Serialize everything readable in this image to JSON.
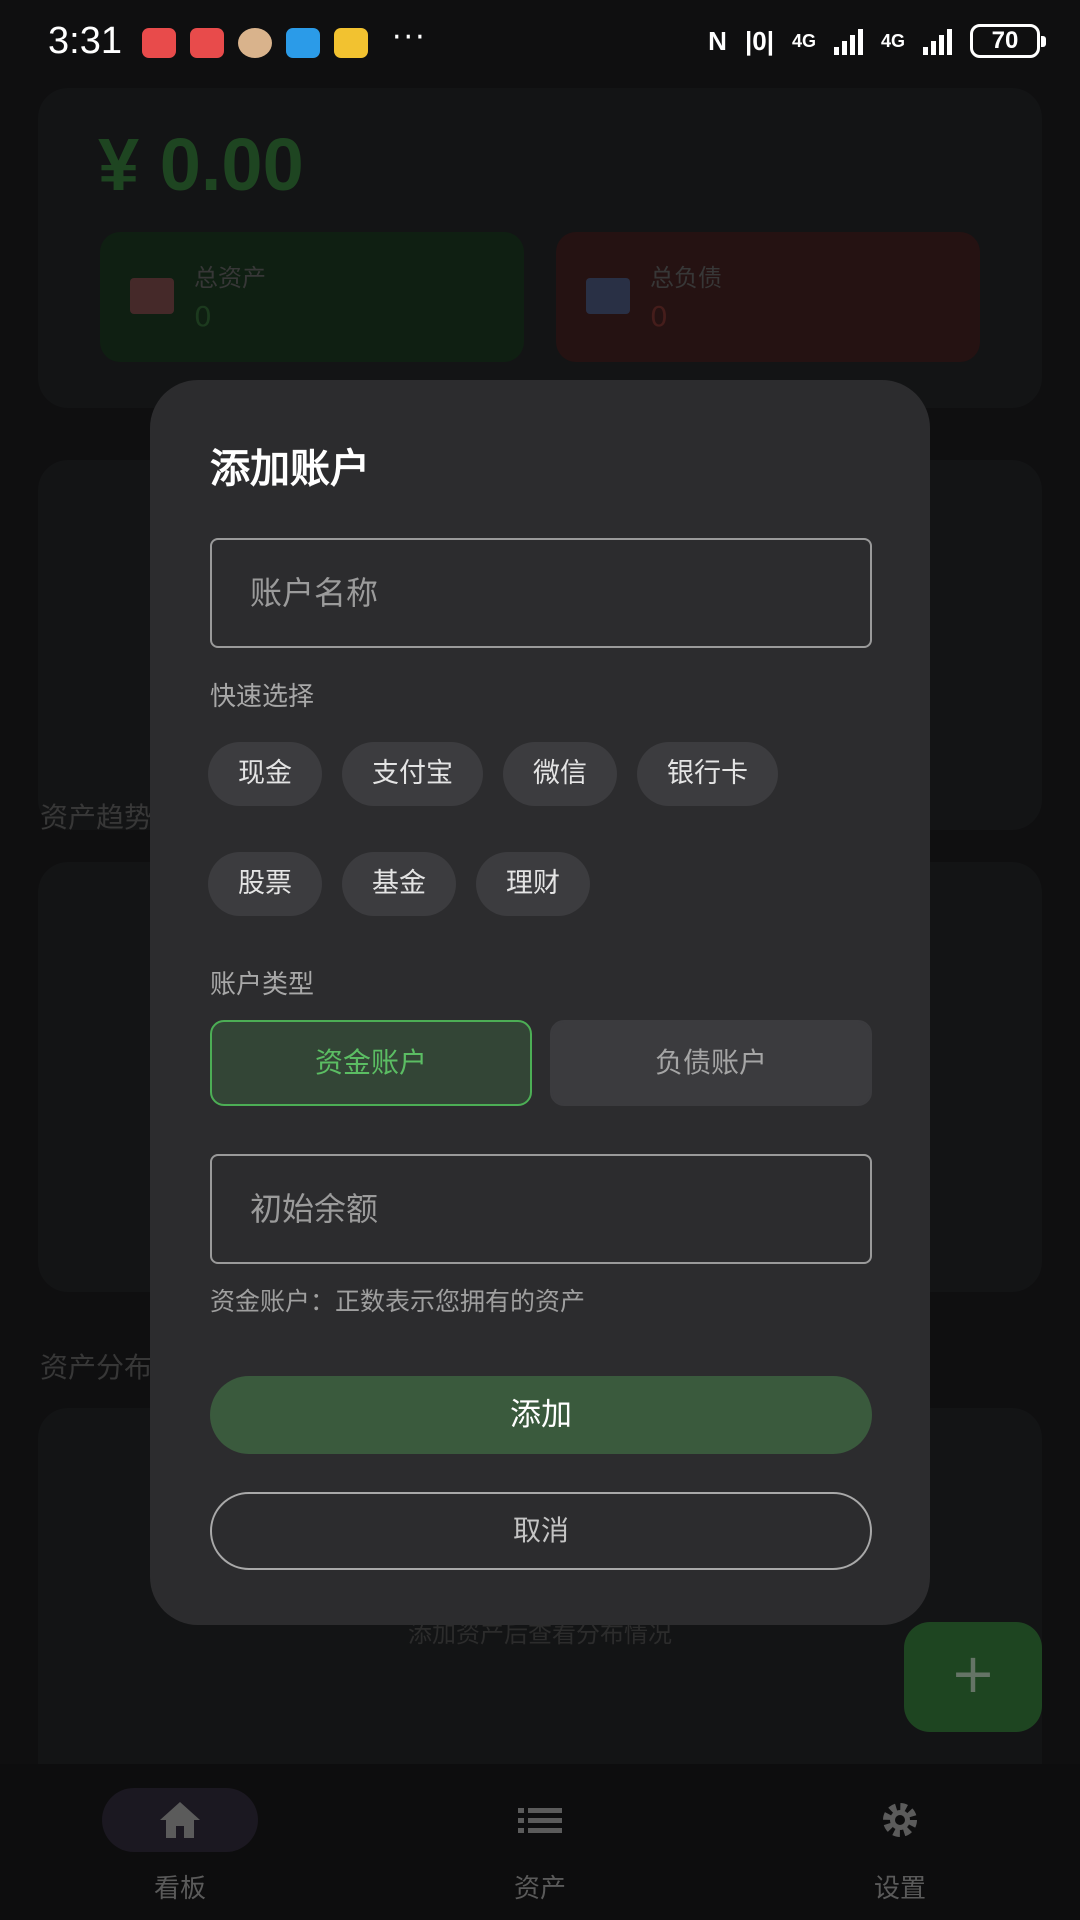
{
  "status_bar": {
    "time": "3:31",
    "more_indicator": "···",
    "nfc": "N",
    "vibrate": "|0|",
    "network_1": "4G",
    "network_2": "4G",
    "battery": "70",
    "app_icon_colors": [
      "#e84b4b",
      "#e84b4b",
      "#d9b38c",
      "#2b9be8",
      "#f2c230"
    ]
  },
  "dashboard": {
    "net_worth": "¥ 0.00",
    "total_assets_label": "总资产",
    "total_assets_value": "0",
    "total_debt_label": "总负债",
    "total_debt_value": "0",
    "trend_section": "资产趋势",
    "distribution_section": "资产分布",
    "distribution_empty_hint": "添加资产后查看分布情况"
  },
  "fab": {
    "icon": "plus-icon",
    "label": "+"
  },
  "bottom_nav": {
    "items": [
      {
        "label": "看板",
        "icon": "home-icon",
        "active": true
      },
      {
        "label": "资产",
        "icon": "list-icon",
        "active": false
      },
      {
        "label": "设置",
        "icon": "gear-icon",
        "active": false
      }
    ]
  },
  "dialog": {
    "title": "添加账户",
    "name_placeholder": "账户名称",
    "quick_select_label": "快速选择",
    "quick_chips_row1": [
      "现金",
      "支付宝",
      "微信",
      "银行卡"
    ],
    "quick_chips_row2": [
      "股票",
      "基金",
      "理财"
    ],
    "account_type_label": "账户类型",
    "type_capital": "资金账户",
    "type_debt": "负债账户",
    "selected_type": "资金账户",
    "balance_placeholder": "初始余额",
    "hint": "资金账户：正数表示您拥有的资产",
    "add_button": "添加",
    "cancel_button": "取消"
  },
  "colors": {
    "accent_green": "#4cae55",
    "add_button": "#3a5a3d",
    "dialog_bg": "#2c2c2e",
    "fab": "#2e6a34"
  }
}
